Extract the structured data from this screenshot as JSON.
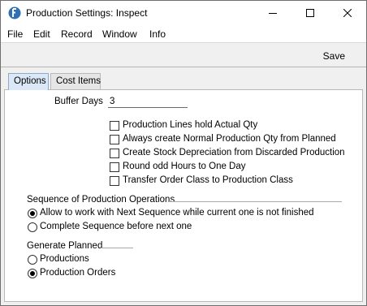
{
  "window": {
    "title": "Production Settings: Inspect",
    "icons": {
      "app": "app-icon",
      "minimize": "minimize-icon",
      "maximize": "maximize-icon",
      "close": "close-icon"
    }
  },
  "menu": {
    "file": "File",
    "edit": "Edit",
    "record": "Record",
    "window": "Window",
    "info": "Info"
  },
  "toolbar": {
    "save_label": "Save"
  },
  "tabs": [
    {
      "label": "Options",
      "selected": true
    },
    {
      "label": "Cost Items",
      "selected": false
    }
  ],
  "buffer_days": {
    "label": "Buffer Days",
    "value": "3"
  },
  "checkboxes": [
    {
      "label": "Production Lines hold Actual Qty",
      "checked": false
    },
    {
      "label": "Always create Normal Production Qty from Planned",
      "checked": false
    },
    {
      "label": "Create Stock Depreciation from Discarded Production",
      "checked": false
    },
    {
      "label": "Round odd Hours to One Day",
      "checked": false
    },
    {
      "label": "Transfer Order Class to Production Class",
      "checked": false
    }
  ],
  "sequence": {
    "title": "Sequence of Production Operations",
    "options": [
      {
        "label": "Allow to work with Next Sequence while current one is not finished",
        "selected": true
      },
      {
        "label": "Complete Sequence before next one",
        "selected": false
      }
    ]
  },
  "generate": {
    "title": "Generate Planned",
    "options": [
      {
        "label": "Productions",
        "selected": false
      },
      {
        "label": "Production Orders",
        "selected": true
      }
    ]
  }
}
